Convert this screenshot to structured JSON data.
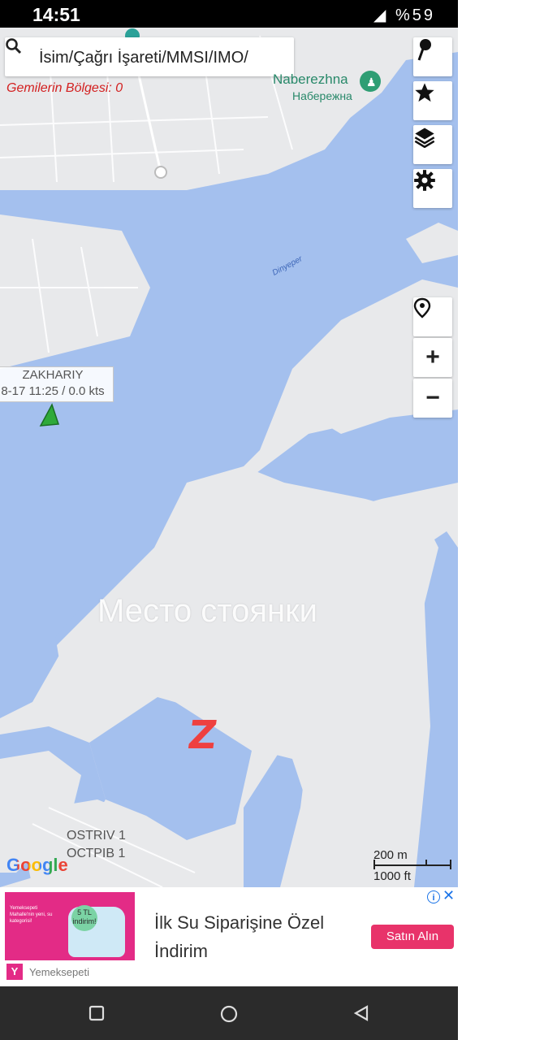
{
  "status_bar": {
    "time": "14:51",
    "battery": "%59"
  },
  "search": {
    "placeholder": "İsim/Çağrı İşareti/MMSI/IMO/"
  },
  "area_count": "Gemilerin Bölgesi: 0",
  "map": {
    "poi_latin": "Naberezhna",
    "poi_cyrillic": "Набережна",
    "river_label": "Dinyeper",
    "vessel": {
      "name": "ZAKHARIY",
      "info": "8-17 11:25 / 0.0 kts",
      "marker_color": "#2faa3a"
    },
    "place_latin": "OSTRIV 1",
    "place_cyrillic": "ОСТРІВ 1",
    "overlay_text": "Место стоянки",
    "overlay_symbol": "Z",
    "overlay_symbol_color": "#ee4040",
    "scale": {
      "metric": "200 m",
      "imperial": "1000 ft"
    },
    "attribution": "Google",
    "colors": {
      "water": "#a4c0ee",
      "land": "#e8e9eb"
    }
  },
  "controls": {
    "zoom_in": "+",
    "zoom_out": "−"
  },
  "ad": {
    "title": "İlk Su Siparişine Özel İndirim",
    "cta": "Satın Alın",
    "brand": "Yemeksepeti",
    "brand_logo_letter": "Y",
    "image_badge": "5 TL indirim!",
    "image_text": "Yemeksepeti Mahalle'nin yeni, su kategorisi!"
  },
  "icons": [
    "search-icon",
    "pin-icon",
    "star-icon",
    "layers-icon",
    "gear-icon",
    "location-pin-icon",
    "info-icon",
    "close-icon",
    "nav-recents-icon",
    "nav-home-icon",
    "nav-back-icon"
  ]
}
